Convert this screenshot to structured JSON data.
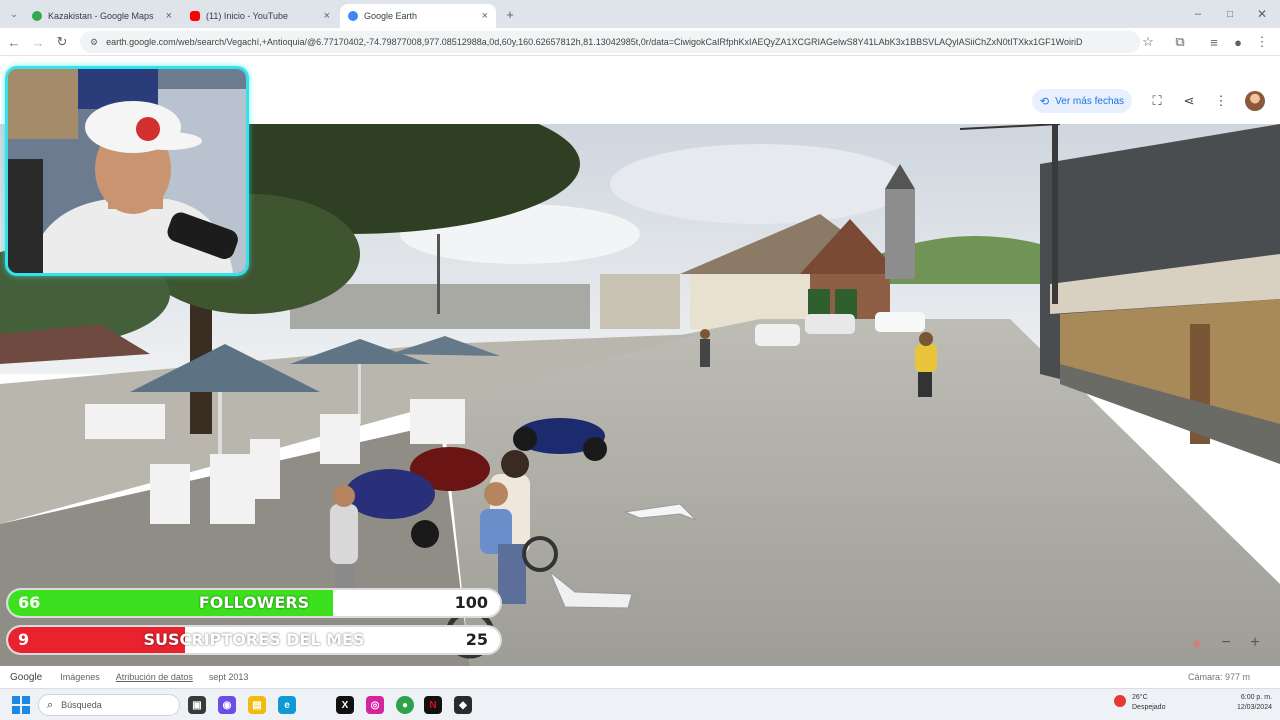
{
  "browser": {
    "tabs": [
      {
        "title": "Kazakistan - Google Maps",
        "favicon_color": "#34a853",
        "active": false
      },
      {
        "title": "(11) Inicio - YouTube",
        "favicon_color": "#ff0000",
        "active": false
      },
      {
        "title": "Google Earth",
        "favicon_color": "#4285f4",
        "active": true
      }
    ],
    "new_tab_symbol": "+",
    "url": "earth.google.com/web/search/Vegachí,+Antioquia/@6.77170402,-74.79877008,977.08512988a,0d,60y,160.62657812h,81.13042985t,0r/data=CiwigokCaIRfphKxIAEQyZA1XCGRIAGelwS8Y41LAbK3x1BBSVLAQylASiiChZxN0tITXkx1GF1WoiriD"
  },
  "earth_header": {
    "more_dates_label": "Ver más fechas",
    "icons": [
      "fullscreen-icon",
      "share-icon",
      "more-vert-icon"
    ]
  },
  "overlay": {
    "followers": {
      "current": 66,
      "label": "FOLLOWERS",
      "goal": 100,
      "color": "#3ce01e"
    },
    "subscribers": {
      "current": 9,
      "label": "SUSCRIPTORES DEL MES",
      "goal": 25,
      "color": "#e8232d"
    }
  },
  "earth_footer": {
    "brand": "Google",
    "imagery": "Imágenes",
    "attribution": "Atribución de datos",
    "date": "sept 2013",
    "camera": "Cámara: 977 m"
  },
  "taskbar": {
    "search_placeholder": "Búsqueda",
    "weather_temp": "26°C",
    "weather_desc": "Despejado",
    "time": "6:00 p. m.",
    "date": "12/03/2024",
    "apps": [
      "file-explorer",
      "chat",
      "files",
      "edge",
      "x-twitter",
      "instagram",
      "chrome",
      "netflix",
      "game"
    ]
  }
}
